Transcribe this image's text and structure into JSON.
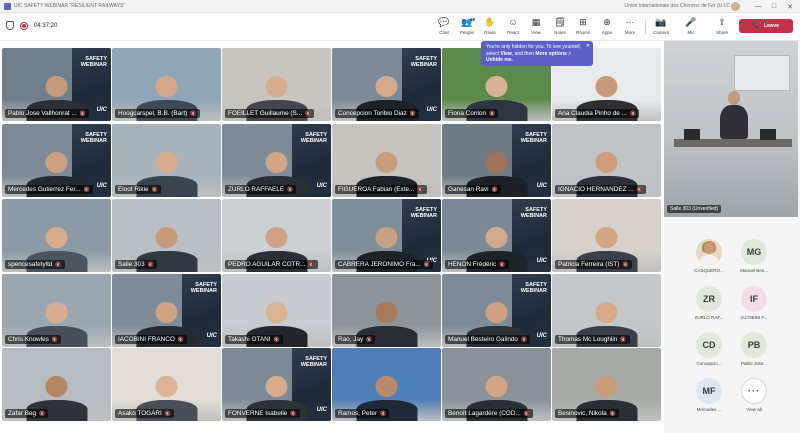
{
  "window": {
    "title": "UIC SAFETY WEBINAR \"RESILIENT RAILWAYS\"",
    "org": "Union Internationale des Chemins de Fer (U.I.C",
    "controls": {
      "minimize": "—",
      "maximize": "□",
      "close": "✕"
    }
  },
  "meeting": {
    "timer": "04:37:20"
  },
  "toolbar": {
    "chat": "Chat",
    "people": "People",
    "people_count": "66",
    "raise": "Raise",
    "react": "React",
    "view": "View",
    "notes": "Notes",
    "rooms": "Rooms",
    "apps": "Apps",
    "more": "More",
    "camera": "Camera",
    "mic": "Mic",
    "share": "Share",
    "leave": "Leave"
  },
  "icons": {
    "chat": "💬",
    "people": "👥",
    "raise": "✋",
    "react": "☺",
    "view": "▦",
    "notes": "🗒",
    "rooms": "⊞",
    "apps": "⊕",
    "more": "···",
    "camera": "📷",
    "mic": "🎤",
    "share": "⇪",
    "leave": "📞",
    "mic_off": "🎤̸"
  },
  "tooltip": {
    "line1": "You're only hidden for you. To see yourself, select ",
    "view": "View",
    "line2": ", and then ",
    "more_options": "More options",
    "line3": " > ",
    "unhide": "Unhide me."
  },
  "banner": {
    "title_line1": "SAFETY",
    "title_line2": "WEBINAR",
    "logo": "UIC"
  },
  "tiles": [
    {
      "name": "Pablo Jose Vallhonrat ...",
      "bg": "#6f7f8c",
      "skin": "#c69b7b",
      "shirt": "#2b2f36",
      "banner": true
    },
    {
      "name": "Hoogcarspel, B.B. (Bart)",
      "bg": "#8fa6b8",
      "skin": "#d3a88a",
      "shirt": "#3e4a58",
      "banner": false
    },
    {
      "name": "FOEILLET Guillaume (S...",
      "bg": "#c9c6c0",
      "skin": "#d6ad8f",
      "shirt": "#43474d",
      "banner": false
    },
    {
      "name": "Concepcion Toribio Diaz",
      "bg": "#7b8a96",
      "skin": "#d4a98b",
      "shirt": "#1e2227",
      "banner": true
    },
    {
      "name": "Fiona Conlon",
      "bg": "#5c8a4a",
      "skin": "#d8b294",
      "shirt": "#2e3440",
      "banner": false
    },
    {
      "name": "Ana Claudia Pinho de ...",
      "bg": "#e9eaec",
      "skin": "#c89b7a",
      "shirt": "#2d2f33",
      "banner": false
    },
    {
      "name": "Mercedes Gutierrez Fer...",
      "bg": "#7c8b97",
      "skin": "#cfa07f",
      "shirt": "#262a30",
      "banner": true
    },
    {
      "name": "Eloot Rikie",
      "bg": "#a7b2bb",
      "skin": "#d7ad8e",
      "shirt": "#3a4450",
      "banner": false
    },
    {
      "name": "ZURLO RAFFAELE",
      "bg": "#7d8c98",
      "skin": "#d1a586",
      "shirt": "#2a2e35",
      "banner": true
    },
    {
      "name": "FIGUEROA Fabian (Exte...",
      "bg": "#c7c3be",
      "skin": "#c79d7c",
      "shirt": "#1f2429",
      "banner": false
    },
    {
      "name": "Ganesan Ravi",
      "bg": "#6c7b86",
      "skin": "#9f7355",
      "shirt": "#1d2025",
      "banner": true
    },
    {
      "name": "IGNACIO HERNANDEZ ...",
      "bg": "#bfc3c6",
      "skin": "#cf9f7d",
      "shirt": "#2c3137",
      "banner": false
    },
    {
      "name": "spencesafetyltd",
      "bg": "#8a9aa6",
      "skin": "#d8ab8b",
      "shirt": "#4b5560",
      "banner": false
    },
    {
      "name": "Salle 303",
      "bg": "#b9bfc4",
      "skin": "#c79a79",
      "shirt": "#333840",
      "banner": false
    },
    {
      "name": "PEDRO AGUILAR COTR...",
      "bg": "#ccd0d3",
      "skin": "#cfa385",
      "shirt": "#2a2f36",
      "banner": false
    },
    {
      "name": "CABRERA JERONIMO Fra...",
      "bg": "#7e8e9a",
      "skin": "#caa083",
      "shirt": "#1d2228",
      "banner": true
    },
    {
      "name": "HENON Frédéric",
      "bg": "#7a8995",
      "skin": "#d2a98b",
      "shirt": "#1e2329",
      "banner": true
    },
    {
      "name": "Patricia Ferreira (IST)",
      "bg": "#d6d2cb",
      "skin": "#d4a484",
      "shirt": "#3c4048",
      "banner": false
    },
    {
      "name": "Chris Knowles",
      "bg": "#9aa7b1",
      "skin": "#d8ae90",
      "shirt": "#474f59",
      "banner": false
    },
    {
      "name": "IACOBINI FRANCO",
      "bg": "#7d8c98",
      "skin": "#d0a384",
      "shirt": "#262a31",
      "banner": true
    },
    {
      "name": "Takashi OTANI",
      "bg": "#c8ccd0",
      "skin": "#d9b394",
      "shirt": "#22262c",
      "banner": false
    },
    {
      "name": "Rao, Jay",
      "bg": "#8d9499",
      "skin": "#a87a5c",
      "shirt": "#2a2e34",
      "banner": false
    },
    {
      "name": "Manuel Besteiro Galindo",
      "bg": "#7c8b97",
      "skin": "#cf9f80",
      "shirt": "#2c3036",
      "banner": true
    },
    {
      "name": "Thomas Mc Loughlin",
      "bg": "#c4c8ca",
      "skin": "#d5a98a",
      "shirt": "#3a3f46",
      "banner": false
    },
    {
      "name": "Zafar Beg",
      "bg": "#b6bcc1",
      "skin": "#b58663",
      "shirt": "#2f3339",
      "banner": false
    },
    {
      "name": "Asako TOGARI",
      "bg": "#e2ddd6",
      "skin": "#dbb497",
      "shirt": "#4a4f57",
      "banner": false
    },
    {
      "name": "FONVERNE Isabelle",
      "bg": "#7b8a96",
      "skin": "#d6ab8c",
      "shirt": "#2d3238",
      "banner": true
    },
    {
      "name": "Ramos, Peter",
      "bg": "#4f7fb8",
      "skin": "#b98a6a",
      "shirt": "#1f2a38",
      "banner": false
    },
    {
      "name": "Benoît Lagardère (CGD...",
      "bg": "#8a9199",
      "skin": "#d2a586",
      "shirt": "#2a2e35",
      "banner": false
    },
    {
      "name": "Besinovic, Nikola",
      "bg": "#a7a9a6",
      "skin": "#c99c7c",
      "shirt": "#2b2f34",
      "banner": false
    }
  ],
  "side_video": {
    "name": "Salle 303 (Unverified)"
  },
  "avatars": [
    {
      "initials": "",
      "label": "CASQUERO...",
      "bg": "#e8d7c7",
      "photo": true
    },
    {
      "initials": "MG",
      "label": "Manuel Bes...",
      "bg": "#dfe8da"
    },
    {
      "initials": "ZR",
      "label": "ZURLO RAF...",
      "bg": "#dfe8da"
    },
    {
      "initials": "IF",
      "label": "IACOBINI F...",
      "bg": "#f5dde7"
    },
    {
      "initials": "CD",
      "label": "Concepcio...",
      "bg": "#dfe8da"
    },
    {
      "initials": "PB",
      "label": "Pablo Jose...",
      "bg": "#dfe8da"
    },
    {
      "initials": "MF",
      "label": "Mercedes ...",
      "bg": "#dde6f3"
    },
    {
      "initials": "···",
      "label": "View all",
      "bg": "#ffffff",
      "more": true
    }
  ]
}
